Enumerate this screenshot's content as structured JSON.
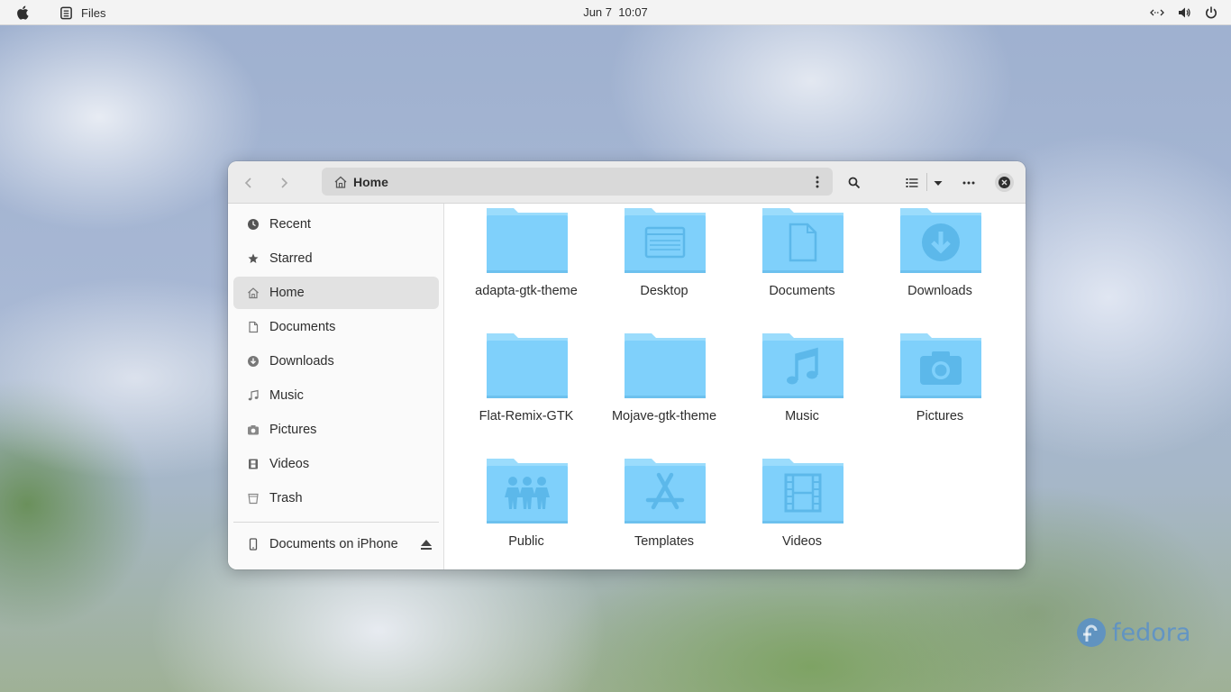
{
  "topbar": {
    "app_name": "Files",
    "date": "Jun 7",
    "time": "10:07"
  },
  "window": {
    "path_label": "Home",
    "sidebar": {
      "items": [
        {
          "label": "Recent",
          "icon": "clock-icon"
        },
        {
          "label": "Starred",
          "icon": "star-icon"
        },
        {
          "label": "Home",
          "icon": "home-icon",
          "active": true
        },
        {
          "label": "Documents",
          "icon": "document-icon"
        },
        {
          "label": "Downloads",
          "icon": "download-icon"
        },
        {
          "label": "Music",
          "icon": "music-note-icon"
        },
        {
          "label": "Pictures",
          "icon": "camera-icon"
        },
        {
          "label": "Videos",
          "icon": "film-icon"
        },
        {
          "label": "Trash",
          "icon": "trash-icon"
        }
      ],
      "device": {
        "label": "Documents on iPhone",
        "icon": "phone-icon"
      }
    },
    "folders": [
      {
        "name": "adapta-gtk-theme",
        "emblem": "none"
      },
      {
        "name": "Desktop",
        "emblem": "desktop-icon"
      },
      {
        "name": "Documents",
        "emblem": "document-icon"
      },
      {
        "name": "Downloads",
        "emblem": "download-icon"
      },
      {
        "name": "Flat-Remix-GTK",
        "emblem": "none"
      },
      {
        "name": "Mojave-gtk-theme",
        "emblem": "none"
      },
      {
        "name": "Music",
        "emblem": "music-note-icon"
      },
      {
        "name": "Pictures",
        "emblem": "camera-icon"
      },
      {
        "name": "Public",
        "emblem": "people-icon"
      },
      {
        "name": "Templates",
        "emblem": "app-store-icon"
      },
      {
        "name": "Videos",
        "emblem": "film-icon"
      }
    ]
  },
  "wallpaper": {
    "logo_text": "fedora"
  },
  "colors": {
    "folder_body": "#7fd0fb",
    "folder_tab": "#9bdcfc",
    "folder_emblem": "#5cb8ea",
    "accent_text": "#2d2d2d"
  }
}
